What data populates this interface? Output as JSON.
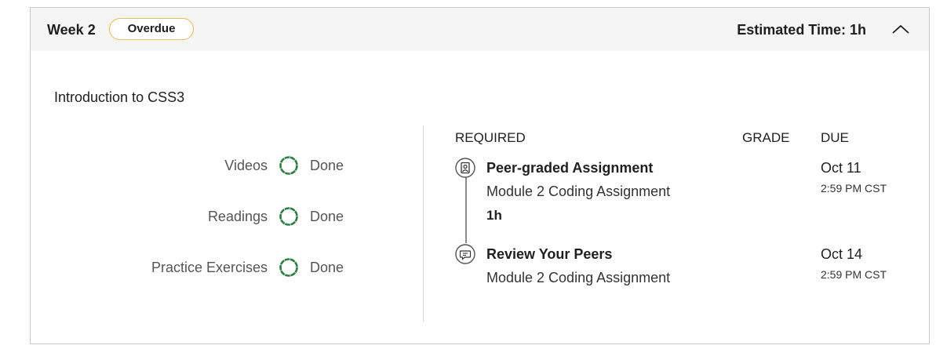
{
  "header": {
    "week_label": "Week 2",
    "badge": "Overdue",
    "estimated_time": "Estimated Time: 1h",
    "collapse_icon": "chevron-up-icon"
  },
  "module": {
    "title": "Introduction to CSS3"
  },
  "progress": [
    {
      "label": "Videos",
      "status": "Done",
      "icon": "progress-ring-icon"
    },
    {
      "label": "Readings",
      "status": "Done",
      "icon": "progress-ring-icon"
    },
    {
      "label": "Practice Exercises",
      "status": "Done",
      "icon": "progress-ring-icon"
    }
  ],
  "table": {
    "headers": {
      "required": "REQUIRED",
      "grade": "GRADE",
      "due": "DUE"
    },
    "items": [
      {
        "icon": "peer-graded-assignment-icon",
        "title": "Peer-graded Assignment",
        "subtitle": "Module 2 Coding Assignment",
        "duration": "1h",
        "due_date": "Oct 11",
        "due_time": "2:59 PM CST"
      },
      {
        "icon": "review-peers-icon",
        "title": "Review Your Peers",
        "subtitle": "Module 2 Coding Assignment",
        "due_date": "Oct 14",
        "due_time": "2:59 PM CST"
      }
    ]
  },
  "colors": {
    "badge_border": "#e8b95f",
    "done_green": "#2f7d45",
    "header_bg": "#f5f5f5"
  }
}
